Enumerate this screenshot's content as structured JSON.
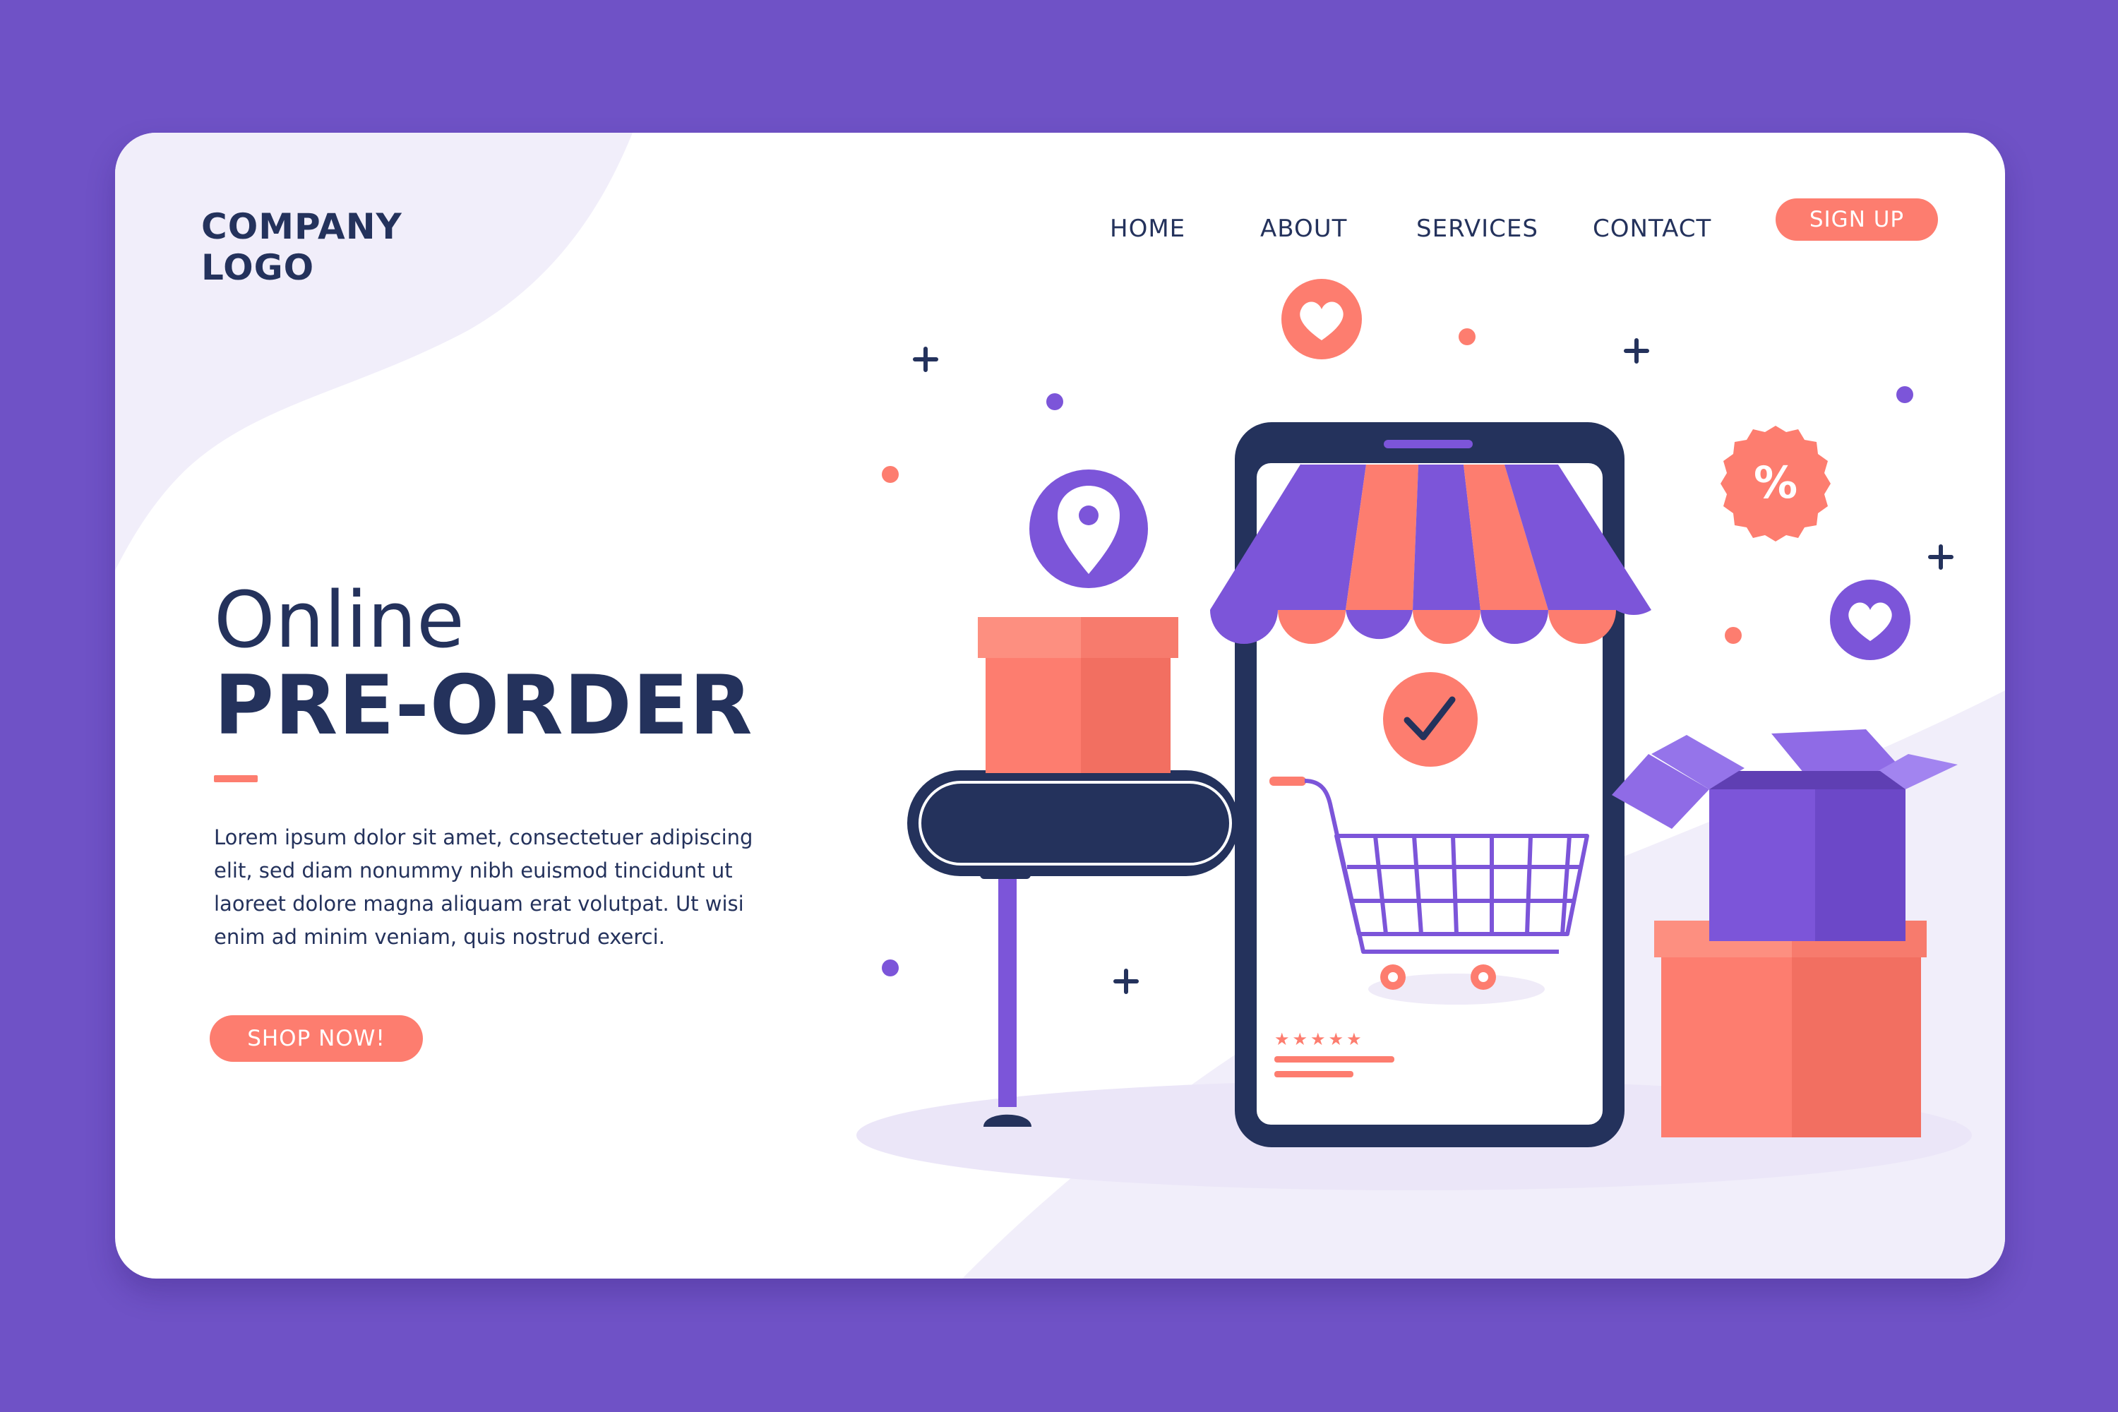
{
  "header": {
    "logo_line1": "COMPANY",
    "logo_line2": "LOGO"
  },
  "nav": {
    "items": [
      {
        "label": "HOME"
      },
      {
        "label": "ABOUT"
      },
      {
        "label": "SERVICES"
      },
      {
        "label": "CONTACT"
      }
    ],
    "signup_label": "SIGN UP"
  },
  "hero": {
    "title_line1": "Online",
    "title_line2": "PRE-ORDER",
    "description": "Lorem ipsum dolor sit amet, consectetuer adipiscing elit, sed diam nonummy nibh euismod tincidunt ut laoreet dolore magna aliquam erat volutpat. Ut wisi enim ad minim veniam, quis nostrud exerci.",
    "cta_label": "SHOP NOW!"
  },
  "illustration": {
    "percent_badge": "%",
    "rating_stars": "★★★★★",
    "icons": [
      "heart-icon",
      "location-pin-icon",
      "percent-badge-icon",
      "check-icon",
      "shopping-cart-icon",
      "heart-icon"
    ]
  },
  "colors": {
    "background": "#6f52c6",
    "card": "#ffffff",
    "navy": "#24325c",
    "coral": "#fd7d6f",
    "purple": "#7c55d9",
    "lavender": "#f1eefa"
  }
}
